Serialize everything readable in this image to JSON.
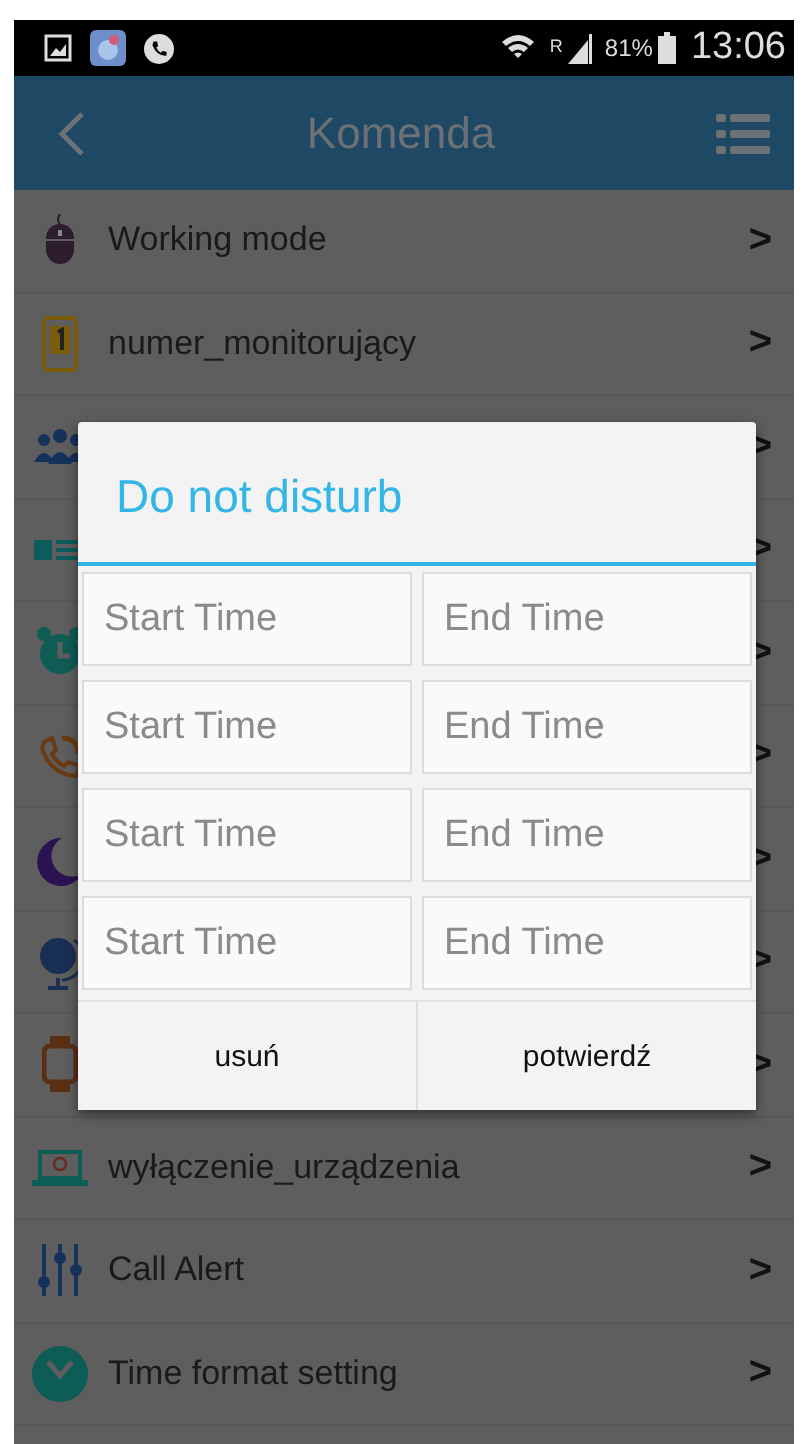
{
  "status_bar": {
    "roaming": "R",
    "battery": "81%",
    "time": "13:06"
  },
  "header": {
    "title": "Komenda"
  },
  "items": [
    {
      "label": "Working mode",
      "chevron": ">"
    },
    {
      "label": "numer_monitorujący",
      "chevron": ">"
    },
    {
      "chevron": ">"
    },
    {
      "chevron": ">"
    },
    {
      "chevron": ">"
    },
    {
      "chevron": ">"
    },
    {
      "chevron": ">"
    },
    {
      "chevron": ">"
    },
    {
      "chevron": ">"
    },
    {
      "label": "wyłączenie_urządzenia",
      "chevron": ">"
    },
    {
      "label": "Call Alert",
      "chevron": ">"
    },
    {
      "label": "Time format setting",
      "chevron": ">"
    }
  ],
  "dialog": {
    "title": "Do not disturb",
    "periods": [
      {
        "start": {
          "placeholder": "Start Time"
        },
        "end": {
          "placeholder": "End Time"
        }
      },
      {
        "start": {
          "placeholder": "Start Time"
        },
        "end": {
          "placeholder": "End Time"
        }
      },
      {
        "start": {
          "placeholder": "Start Time"
        },
        "end": {
          "placeholder": "End Time"
        }
      },
      {
        "start": {
          "placeholder": "Start Time"
        },
        "end": {
          "placeholder": "End Time"
        }
      }
    ],
    "buttons": [
      "usuń",
      "potwierdź"
    ]
  }
}
